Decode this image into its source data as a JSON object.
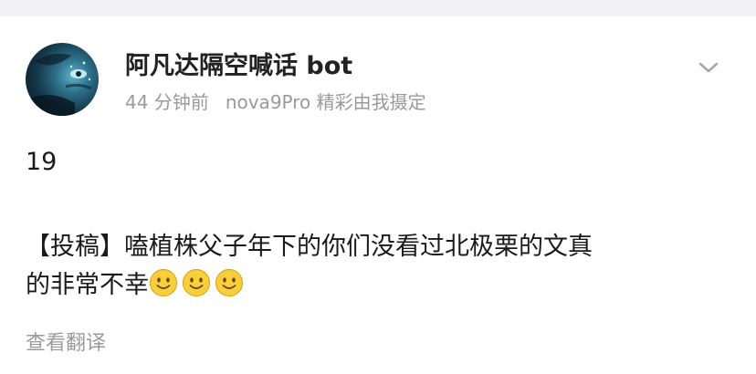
{
  "post": {
    "username": "阿凡达隔空喊话 bot",
    "time": "44 分钟前",
    "device": "nova9Pro 精彩由我摄定",
    "number": "19",
    "body_line1": "【投稿】嗑植株父子年下的你们没看过北极栗的文真",
    "body_line2": "的非常不幸",
    "emojis": [
      "smile-emoji",
      "smile-emoji",
      "smile-emoji"
    ],
    "translate_label": "查看翻译"
  },
  "icons": {
    "more": "chevron-down-icon",
    "avatar": "avatar-image"
  },
  "colors": {
    "text": "#1a1a1a",
    "meta": "#9a9a9a",
    "background_band": "#f1f1f3",
    "emoji": "#f7cf3c"
  }
}
